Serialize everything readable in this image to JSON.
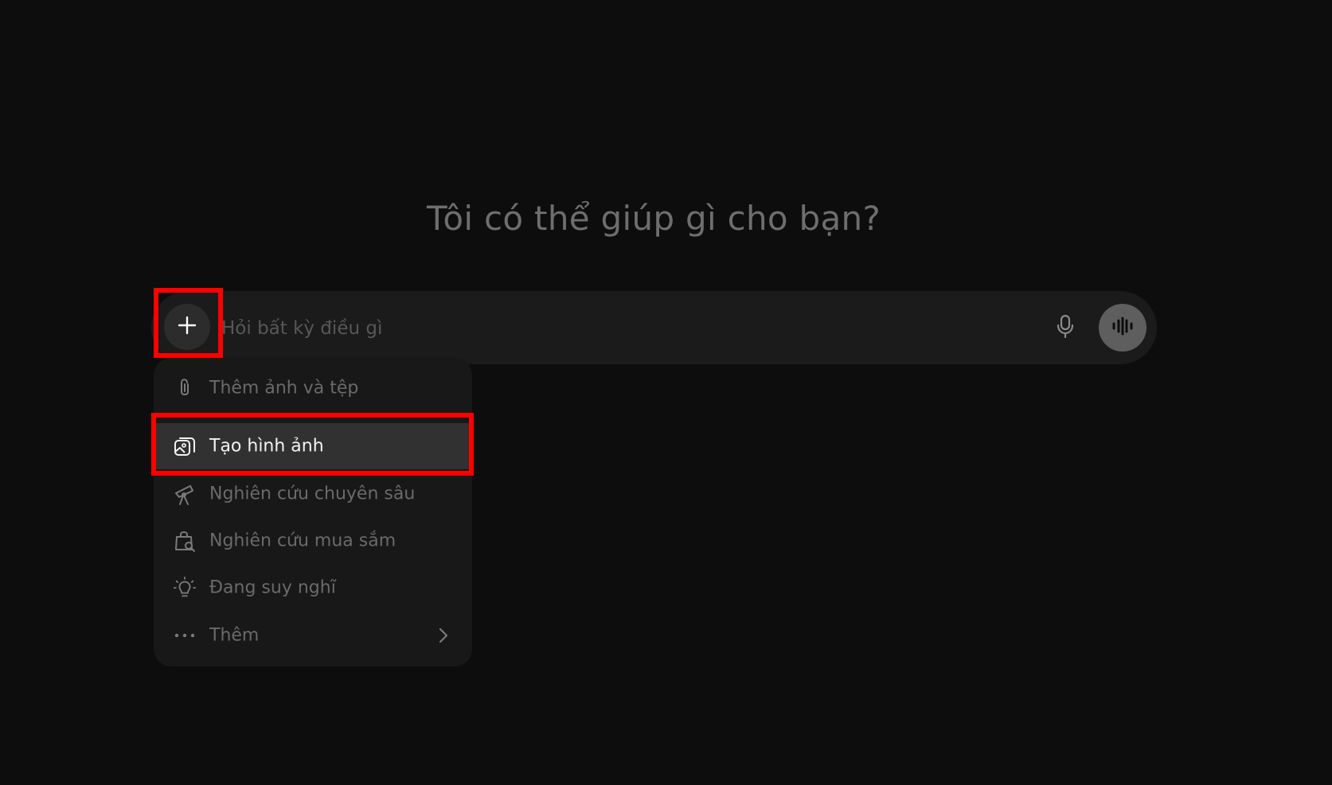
{
  "headline": "Tôi có thể giúp gì cho bạn?",
  "composer": {
    "placeholder": "Hỏi bất kỳ điều gì",
    "add_icon": "plus-icon",
    "mic_icon": "microphone-icon",
    "voice_icon": "voice-waveform-icon"
  },
  "menu": {
    "items": [
      {
        "label": "Thêm ảnh và tệp",
        "icon": "paperclip-icon"
      },
      {
        "label": "Tạo hình ảnh",
        "icon": "image-create-icon",
        "selected": true
      },
      {
        "label": "Nghiên cứu chuyên sâu",
        "icon": "telescope-icon"
      },
      {
        "label": "Nghiên cứu mua sắm",
        "icon": "shopping-bag-search-icon"
      },
      {
        "label": "Đang suy nghĩ",
        "icon": "lightbulb-icon"
      },
      {
        "label": "Thêm",
        "icon": "more-dots-icon",
        "submenu_icon": "chevron-right-icon"
      }
    ]
  },
  "colors": {
    "background": "#0d0d0d",
    "composer": "#1b1b1b",
    "menu": "#181818",
    "selected_item": "#313131",
    "highlight": "#ff0000"
  }
}
